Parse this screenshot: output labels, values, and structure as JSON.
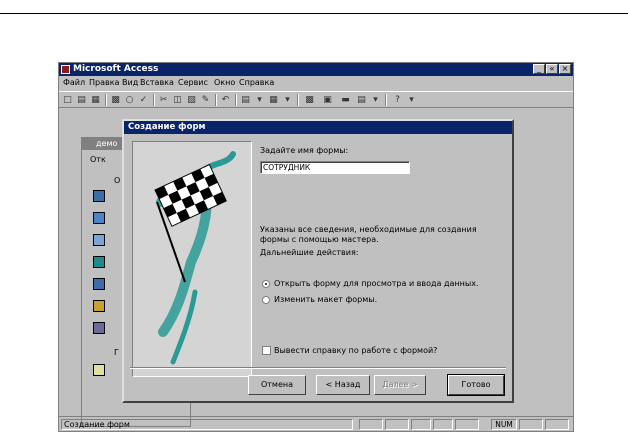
{
  "window": {
    "title": "Microsoft Access",
    "controls": [
      "_",
      "«",
      "×"
    ]
  },
  "menu": [
    "Файл",
    "Правка",
    "Вид",
    "Вставка",
    "Сервис",
    "Окно",
    "Справка"
  ],
  "db_window": {
    "title": "демо",
    "open_label": "Отк",
    "col_label": "О",
    "footer_label": "Г"
  },
  "dialog": {
    "title": "Создание форм",
    "form_name_label": "Задайте имя формы:",
    "form_name_value": "СОТРУДНИК",
    "info_line1": "Указаны все сведения, необходимые для создания",
    "info_line2": "формы с помощью мастера.",
    "next_actions_label": "Дальнейшие действия:",
    "radio_open": "Открыть форму для просмотра и ввода данных.",
    "radio_edit": "Изменить макет формы.",
    "checkbox_help": "Вывести справку по работе с формой?",
    "buttons": {
      "cancel": "Отмена",
      "back": "< Назад",
      "next": "Далее >",
      "finish": "Готово"
    }
  },
  "statusbar": {
    "text": "Создание форм",
    "num": "NUM"
  },
  "colors": {
    "titlebar": "#0a246a",
    "face": "#c0c0c0",
    "flag_accent": "#2a9a95"
  }
}
